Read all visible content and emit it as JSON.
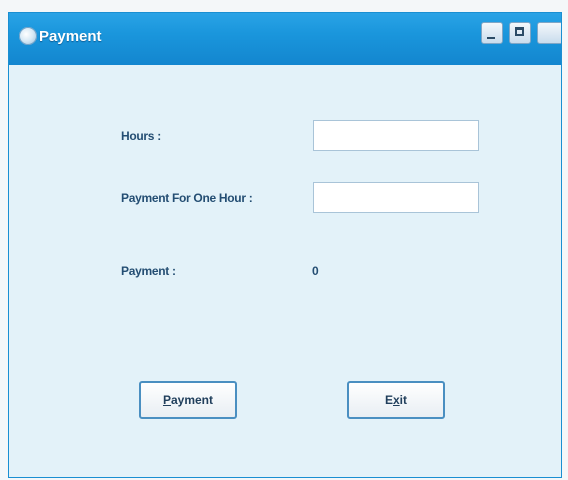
{
  "window": {
    "title": "Payment"
  },
  "form": {
    "hours_label": "Hours :",
    "hours_value": "",
    "rate_label": "Payment For One Hour :",
    "rate_value": "",
    "payment_label": "Payment :",
    "payment_value": "0"
  },
  "buttons": {
    "payment": {
      "mnemonic": "P",
      "rest": "ayment"
    },
    "exit": {
      "before": "E",
      "mnemonic": "x",
      "after": "it"
    }
  },
  "colors": {
    "titlebar": "#1a96dc",
    "client_background": "#e3f2f9",
    "label_text": "#244e73",
    "button_border": "#4a8fc1"
  },
  "icons": {
    "app": "app-icon",
    "minimize": "minimize-icon",
    "maximize": "maximize-icon",
    "close": "close-icon"
  }
}
